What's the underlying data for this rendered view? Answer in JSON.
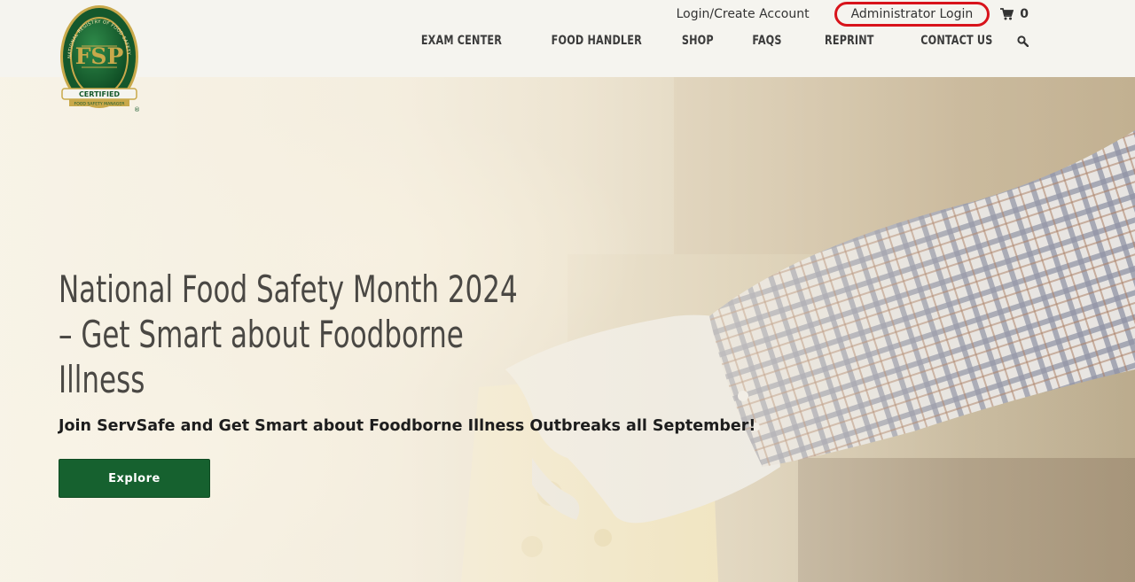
{
  "brand": {
    "logo_ring_text": "NATIONAL REGISTRY OF FOOD SAFETY PROFESSIONALS",
    "logo_letters": "FSP",
    "logo_banner": "CERTIFIED",
    "logo_sub": "FOOD SAFETY MANAGER",
    "logo_registered": "®",
    "colors": {
      "green": "#16612f",
      "gold": "#c9a94b"
    }
  },
  "util_nav": {
    "login": "Login/Create Account",
    "admin": "Administrator Login",
    "cart_count": "0",
    "cart_icon": "cart-icon",
    "highlight_color": "#d8131b"
  },
  "main_nav": {
    "items": [
      "EXAM CENTER",
      "FOOD HANDLER",
      "SHOP",
      "FAQS",
      "REPRINT",
      "CONTACT US"
    ],
    "search_icon": "search-icon"
  },
  "hero": {
    "title_line1": "National Food Safety Month 2024",
    "title_line2": "– Get Smart about Foodborne",
    "title_line3": "Illness",
    "subtitle": "Join ServSafe and Get Smart about Foodborne Illness Outbreaks all September!",
    "cta": "Explore"
  }
}
